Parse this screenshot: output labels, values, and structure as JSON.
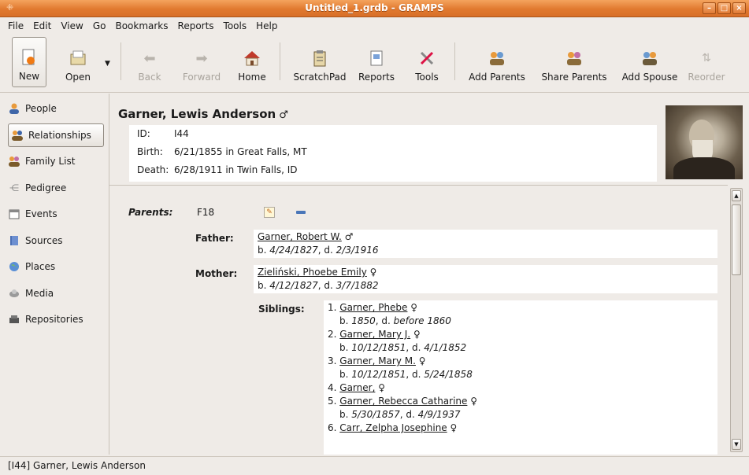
{
  "window": {
    "title": "Untitled_1.grdb - GRAMPS",
    "app_icon": "gramps-tree-icon",
    "controls": [
      "minimize",
      "maximize",
      "close"
    ]
  },
  "menubar": [
    "File",
    "Edit",
    "View",
    "Go",
    "Bookmarks",
    "Reports",
    "Tools",
    "Help"
  ],
  "toolbar": {
    "new": "New",
    "open": "Open",
    "back": "Back",
    "forward": "Forward",
    "home": "Home",
    "scratchpad": "ScratchPad",
    "reports": "Reports",
    "tools": "Tools",
    "add_parents": "Add Parents",
    "share_parents": "Share Parents",
    "add_spouse": "Add Spouse",
    "reorder": "Reorder"
  },
  "sidebar": {
    "items": [
      {
        "label": "People",
        "icon": "people-icon"
      },
      {
        "label": "Relationships",
        "icon": "relationships-icon",
        "active": true
      },
      {
        "label": "Family List",
        "icon": "family-list-icon"
      },
      {
        "label": "Pedigree",
        "icon": "pedigree-icon"
      },
      {
        "label": "Events",
        "icon": "events-icon"
      },
      {
        "label": "Sources",
        "icon": "sources-icon"
      },
      {
        "label": "Places",
        "icon": "places-icon"
      },
      {
        "label": "Media",
        "icon": "media-icon"
      },
      {
        "label": "Repositories",
        "icon": "repositories-icon"
      }
    ]
  },
  "person": {
    "name": "Garner, Lewis Anderson",
    "gender_symbol": "♂",
    "id_label": "ID:",
    "id": "I44",
    "birth_label": "Birth:",
    "birth": "6/21/1855 in Great Falls, MT",
    "death_label": "Death:",
    "death": "6/28/1911 in Twin Falls, ID"
  },
  "parents": {
    "label": "Parents:",
    "family_id": "F18",
    "father_label": "Father:",
    "father": {
      "name": "Garner, Robert W.",
      "symbol": "♂",
      "b_prefix": "b. ",
      "birth": "4/24/1827",
      "d_prefix": ", d. ",
      "death": "2/3/1916"
    },
    "mother_label": "Mother:",
    "mother": {
      "name": "Zieliński, Phoebe Emily",
      "symbol": "♀",
      "b_prefix": "b. ",
      "birth": "4/12/1827",
      "d_prefix": ", d. ",
      "death": "3/7/1882"
    },
    "siblings_label": "Siblings:",
    "siblings": [
      {
        "num": "1.",
        "name": "Garner, Phebe",
        "symbol": "♀",
        "dates": {
          "b": "1850",
          "sep": ", d. ",
          "d": "before 1860"
        }
      },
      {
        "num": "2.",
        "name": "Garner, Mary J.",
        "symbol": "♀",
        "dates": {
          "b": "10/12/1851",
          "sep": ", d. ",
          "d": "4/1/1852"
        }
      },
      {
        "num": "3.",
        "name": "Garner, Mary M.",
        "symbol": "♀",
        "dates": {
          "b": "10/12/1851",
          "sep": ", d. ",
          "d": "5/24/1858"
        }
      },
      {
        "num": "4.",
        "name": "Garner,",
        "symbol": "♀"
      },
      {
        "num": "5.",
        "name": "Garner, Rebecca Catharine",
        "symbol": "♀",
        "dates": {
          "b": "5/30/1857",
          "sep": ", d. ",
          "d": "4/9/1937"
        }
      },
      {
        "num": "6.",
        "name": "Carr, Zelpha Josephine",
        "symbol": "♀"
      }
    ]
  },
  "statusbar": "[I44] Garner, Lewis Anderson"
}
